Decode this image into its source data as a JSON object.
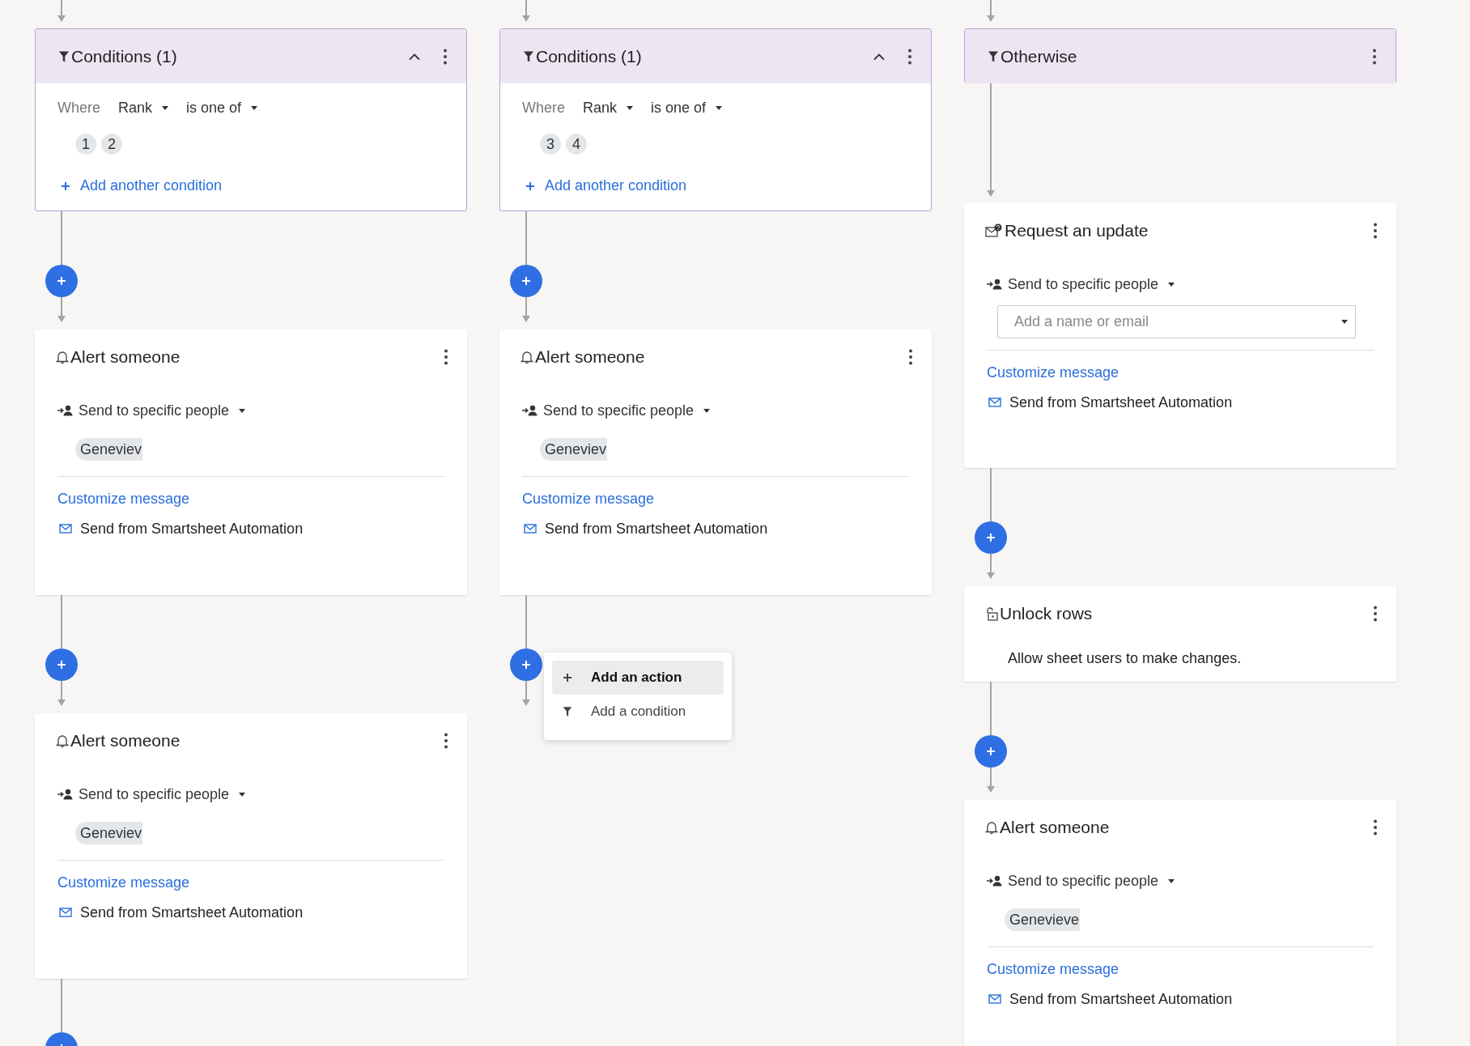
{
  "columns": [
    {
      "steps": [
        {
          "kind": "condition",
          "title": "Conditions (1)",
          "expanded": true,
          "where_label": "Where",
          "field": "Rank",
          "operator": "is one of",
          "values": [
            "1",
            "2"
          ],
          "add_link": "Add another condition"
        },
        {
          "kind": "alert",
          "title": "Alert someone",
          "recipient_mode": "Send to specific people",
          "recipients": [
            "Geneviev"
          ],
          "customize_link": "Customize message",
          "sender": "Send from Smartsheet Automation"
        },
        {
          "kind": "alert",
          "title": "Alert someone",
          "recipient_mode": "Send to specific people",
          "recipients": [
            "Geneviev"
          ],
          "customize_link": "Customize message",
          "sender": "Send from Smartsheet Automation"
        }
      ]
    },
    {
      "steps": [
        {
          "kind": "condition",
          "title": "Conditions (1)",
          "expanded": true,
          "where_label": "Where",
          "field": "Rank",
          "operator": "is one of",
          "values": [
            "3",
            "4"
          ],
          "add_link": "Add another condition"
        },
        {
          "kind": "alert",
          "title": "Alert someone",
          "recipient_mode": "Send to specific people",
          "recipients": [
            "Geneviev"
          ],
          "customize_link": "Customize message",
          "sender": "Send from Smartsheet Automation",
          "add_menu": [
            {
              "kind": "action",
              "label": "Add an action",
              "selected": true
            },
            {
              "kind": "condition",
              "label": "Add a condition",
              "selected": false
            }
          ]
        }
      ]
    },
    {
      "steps": [
        {
          "kind": "otherwise",
          "title": "Otherwise"
        },
        {
          "kind": "request",
          "title": "Request an update",
          "recipient_mode": "Send to specific people",
          "placeholder": "Add a name or email",
          "customize_link": "Customize message",
          "sender": "Send from Smartsheet Automation"
        },
        {
          "kind": "unlock",
          "title": "Unlock rows",
          "description": "Allow sheet users to make changes."
        },
        {
          "kind": "alert",
          "title": "Alert someone",
          "recipient_mode": "Send to specific people",
          "recipients": [
            "Genevieve"
          ],
          "customize_link": "Customize message",
          "sender": "Send from Smartsheet Automation"
        }
      ]
    }
  ]
}
